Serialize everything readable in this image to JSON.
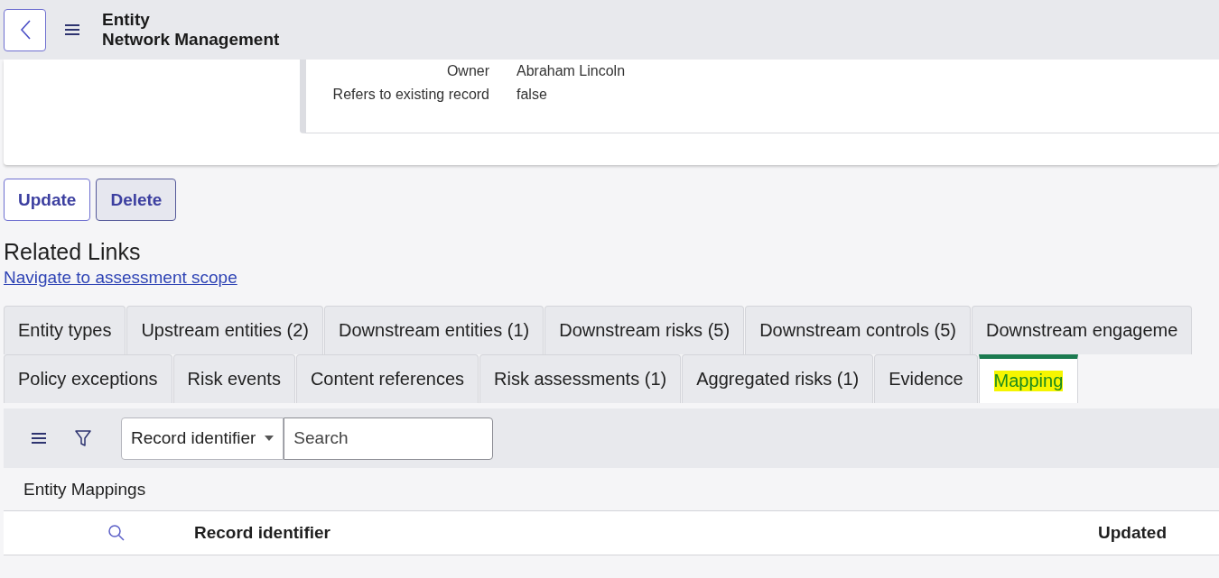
{
  "header": {
    "title": "Entity",
    "subtitle": "Network Management"
  },
  "record_fields": [
    {
      "label": "Owner",
      "value": "Abraham Lincoln"
    },
    {
      "label": "Refers to existing record",
      "value": "false"
    }
  ],
  "buttons": [
    {
      "label": "Update",
      "kind": "outline"
    },
    {
      "label": "Delete",
      "kind": "filled"
    }
  ],
  "related_links": {
    "heading": "Related Links",
    "links": [
      "Navigate to assessment scope"
    ]
  },
  "tab_rows": [
    [
      {
        "label": "Entity types",
        "selected": false
      },
      {
        "label": "Upstream entities (2)",
        "selected": false
      },
      {
        "label": "Downstream entities (1)",
        "selected": false
      },
      {
        "label": "Downstream risks (5)",
        "selected": false
      },
      {
        "label": "Downstream controls (5)",
        "selected": false
      },
      {
        "label": "Downstream engageme",
        "selected": false
      }
    ],
    [
      {
        "label": "Policy exceptions",
        "selected": false
      },
      {
        "label": "Risk events",
        "selected": false
      },
      {
        "label": "Content references",
        "selected": false
      },
      {
        "label": "Risk assessments (1)",
        "selected": false
      },
      {
        "label": "Aggregated risks (1)",
        "selected": false
      },
      {
        "label": "Evidence",
        "selected": false
      },
      {
        "label": "Mapping",
        "selected": true
      }
    ]
  ],
  "list": {
    "search_field": "Record identifier",
    "search": {
      "placeholder": "Search"
    },
    "title": "Entity Mappings",
    "columns": [
      "Record identifier",
      "Updated"
    ]
  }
}
